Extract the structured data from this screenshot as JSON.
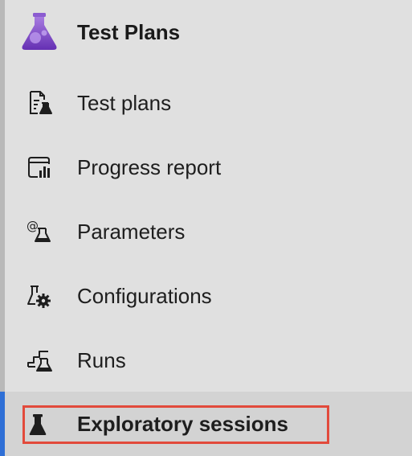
{
  "app": {
    "title": "Test Plans",
    "icon": "flask-icon",
    "colors": {
      "icon_top": "#9a6ad6",
      "icon_bottom": "#6a34b8"
    }
  },
  "nav": {
    "items": [
      {
        "label": "Test plans",
        "icon": "test-plans-icon",
        "selected": false
      },
      {
        "label": "Progress report",
        "icon": "progress-report-icon",
        "selected": false
      },
      {
        "label": "Parameters",
        "icon": "parameters-icon",
        "selected": false
      },
      {
        "label": "Configurations",
        "icon": "configurations-icon",
        "selected": false
      },
      {
        "label": "Runs",
        "icon": "runs-icon",
        "selected": false
      },
      {
        "label": "Exploratory sessions",
        "icon": "exploratory-sessions-icon",
        "selected": true
      }
    ]
  },
  "colors": {
    "selection_accent": "#2f6fd6",
    "highlight_outline": "#e24a3b",
    "background": "#e0e0e0"
  }
}
